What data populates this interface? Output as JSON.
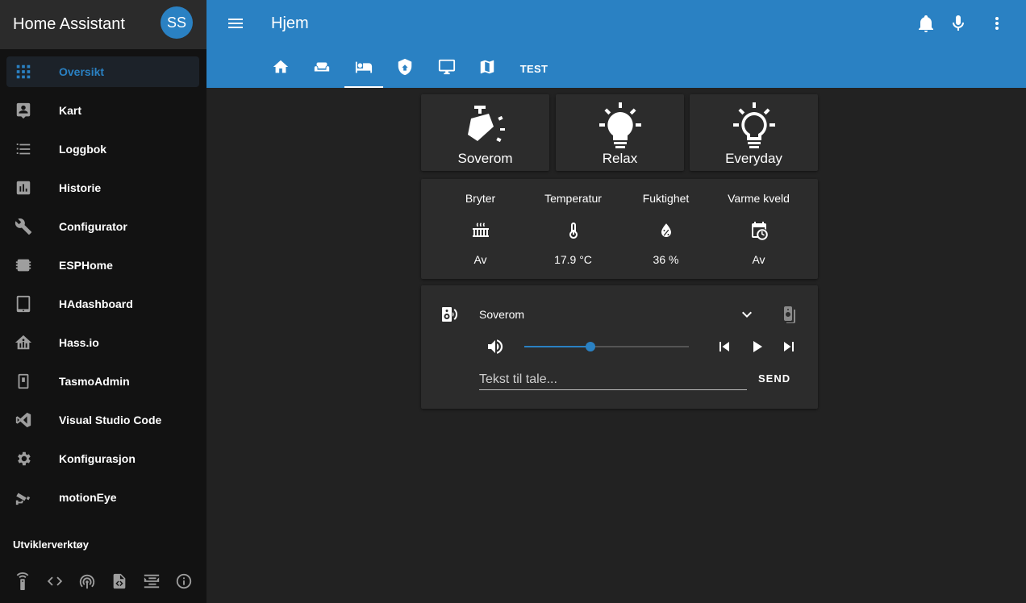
{
  "sidebar": {
    "title": "Home Assistant",
    "avatar_initials": "SS",
    "items": [
      {
        "label": "Oversikt",
        "icon": "view-dashboard-icon",
        "active": true
      },
      {
        "label": "Kart",
        "icon": "account-box-icon"
      },
      {
        "label": "Loggbok",
        "icon": "format-list-bulleted-icon"
      },
      {
        "label": "Historie",
        "icon": "chart-box-icon"
      },
      {
        "label": "Configurator",
        "icon": "wrench-icon"
      },
      {
        "label": "ESPHome",
        "icon": "chip-icon"
      },
      {
        "label": "HAdashboard",
        "icon": "tablet-icon"
      },
      {
        "label": "Hass.io",
        "icon": "home-assistant-icon"
      },
      {
        "label": "TasmoAdmin",
        "icon": "light-switch-icon"
      },
      {
        "label": "Visual Studio Code",
        "icon": "vscode-icon"
      },
      {
        "label": "Konfigurasjon",
        "icon": "cog-icon"
      },
      {
        "label": "motionEye",
        "icon": "cctv-icon"
      }
    ],
    "dev_section_label": "Utviklerverktøy",
    "dev_tools": [
      "remote-icon",
      "code-tags-icon",
      "access-point-icon",
      "file-code-icon",
      "format-list-text-icon",
      "info-icon"
    ]
  },
  "header": {
    "title": "Hjem",
    "tabs": [
      {
        "icon": "home-icon"
      },
      {
        "icon": "sofa-icon"
      },
      {
        "icon": "bed-icon",
        "active": true
      },
      {
        "icon": "shield-home-icon"
      },
      {
        "icon": "monitor-icon"
      },
      {
        "icon": "map-icon"
      },
      {
        "label": "TEST"
      }
    ]
  },
  "scenes": [
    {
      "label": "Soverom",
      "icon": "spotlight-beam-icon"
    },
    {
      "label": "Relax",
      "icon": "lightbulb-on-icon"
    },
    {
      "label": "Everyday",
      "icon": "lightbulb-on-outline-icon"
    }
  ],
  "glance": [
    {
      "name": "Bryter",
      "icon": "radiator-icon",
      "value": "Av"
    },
    {
      "name": "Temperatur",
      "icon": "thermometer-icon",
      "value": "17.9 °C"
    },
    {
      "name": "Fuktighet",
      "icon": "water-percent-icon",
      "value": "36 %"
    },
    {
      "name": "Varme kveld",
      "icon": "calendar-clock-icon",
      "value": "Av"
    }
  ],
  "media": {
    "name": "Soverom",
    "volume": 0.4,
    "tts_placeholder": "Tekst til tale...",
    "send_label": "SEND"
  },
  "colors": {
    "accent": "#2a81c3",
    "sidebar_bg": "#121212",
    "card_bg": "#2c2c2c",
    "page_bg": "#222222"
  }
}
